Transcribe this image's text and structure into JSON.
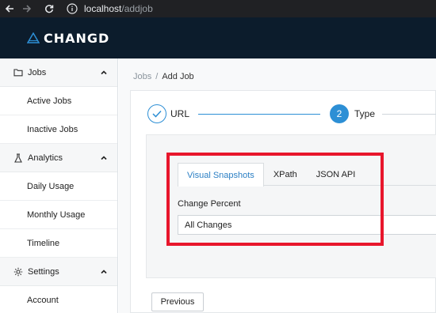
{
  "browser": {
    "url_host": "localhost",
    "url_path": "/addjob"
  },
  "app": {
    "logo_text": "CHANGD",
    "brand_color": "#0c1c2c",
    "accent_color": "#2d8fd5"
  },
  "sidebar": {
    "groups": [
      {
        "label": "Jobs",
        "icon": "folder-icon",
        "items": [
          "Active Jobs",
          "Inactive Jobs"
        ]
      },
      {
        "label": "Analytics",
        "icon": "flask-icon",
        "items": [
          "Daily Usage",
          "Monthly Usage",
          "Timeline"
        ]
      },
      {
        "label": "Settings",
        "icon": "gear-icon",
        "items": [
          "Account"
        ]
      }
    ]
  },
  "breadcrumb": {
    "parent": "Jobs",
    "separator": "/",
    "current": "Add Job"
  },
  "stepper": {
    "steps": [
      {
        "number": "✓",
        "label": "URL",
        "state": "completed"
      },
      {
        "number": "2",
        "label": "Type",
        "state": "active"
      }
    ]
  },
  "tabs": {
    "items": [
      "Visual Snapshots",
      "XPath",
      "JSON API"
    ],
    "active": "Visual Snapshots"
  },
  "form": {
    "change_percent_label": "Change Percent",
    "change_percent_value": "All Changes"
  },
  "buttons": {
    "previous": "Previous"
  },
  "highlight_color": "#e8162c"
}
